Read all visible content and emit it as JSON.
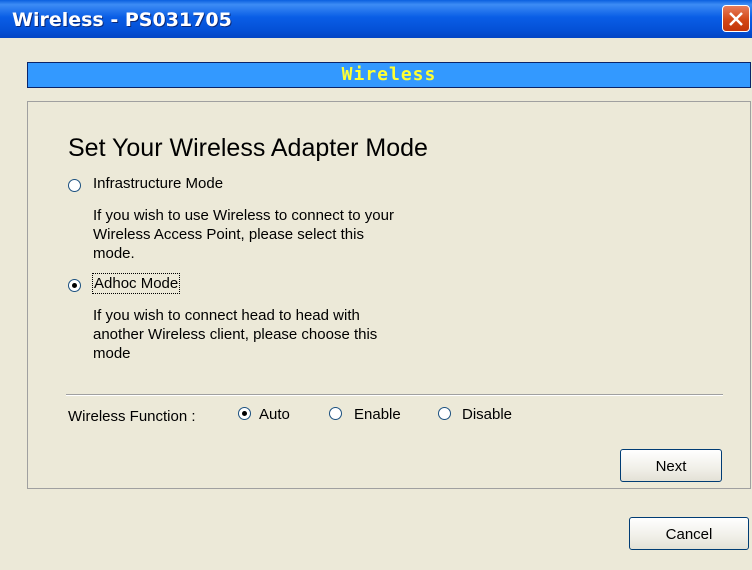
{
  "window": {
    "title": "Wireless - PS031705"
  },
  "banner": {
    "text": "Wireless"
  },
  "main": {
    "heading": "Set Your Wireless Adapter Mode",
    "modes": [
      {
        "label": "Infrastructure Mode",
        "checked": false,
        "description": [
          "If you wish to use Wireless to connect to your",
          "Wireless Access Point, please select this",
          "mode."
        ]
      },
      {
        "label": "Adhoc Mode",
        "checked": true,
        "description": [
          "If you wish to connect head to head with",
          "another Wireless client, please choose this",
          "mode"
        ]
      }
    ],
    "function": {
      "label": "Wireless Function :",
      "options": [
        {
          "label": "Auto",
          "checked": true
        },
        {
          "label": "Enable",
          "checked": false
        },
        {
          "label": "Disable",
          "checked": false
        }
      ]
    }
  },
  "buttons": {
    "next": "Next",
    "cancel": "Cancel"
  },
  "icons": {
    "close": "close-icon"
  }
}
